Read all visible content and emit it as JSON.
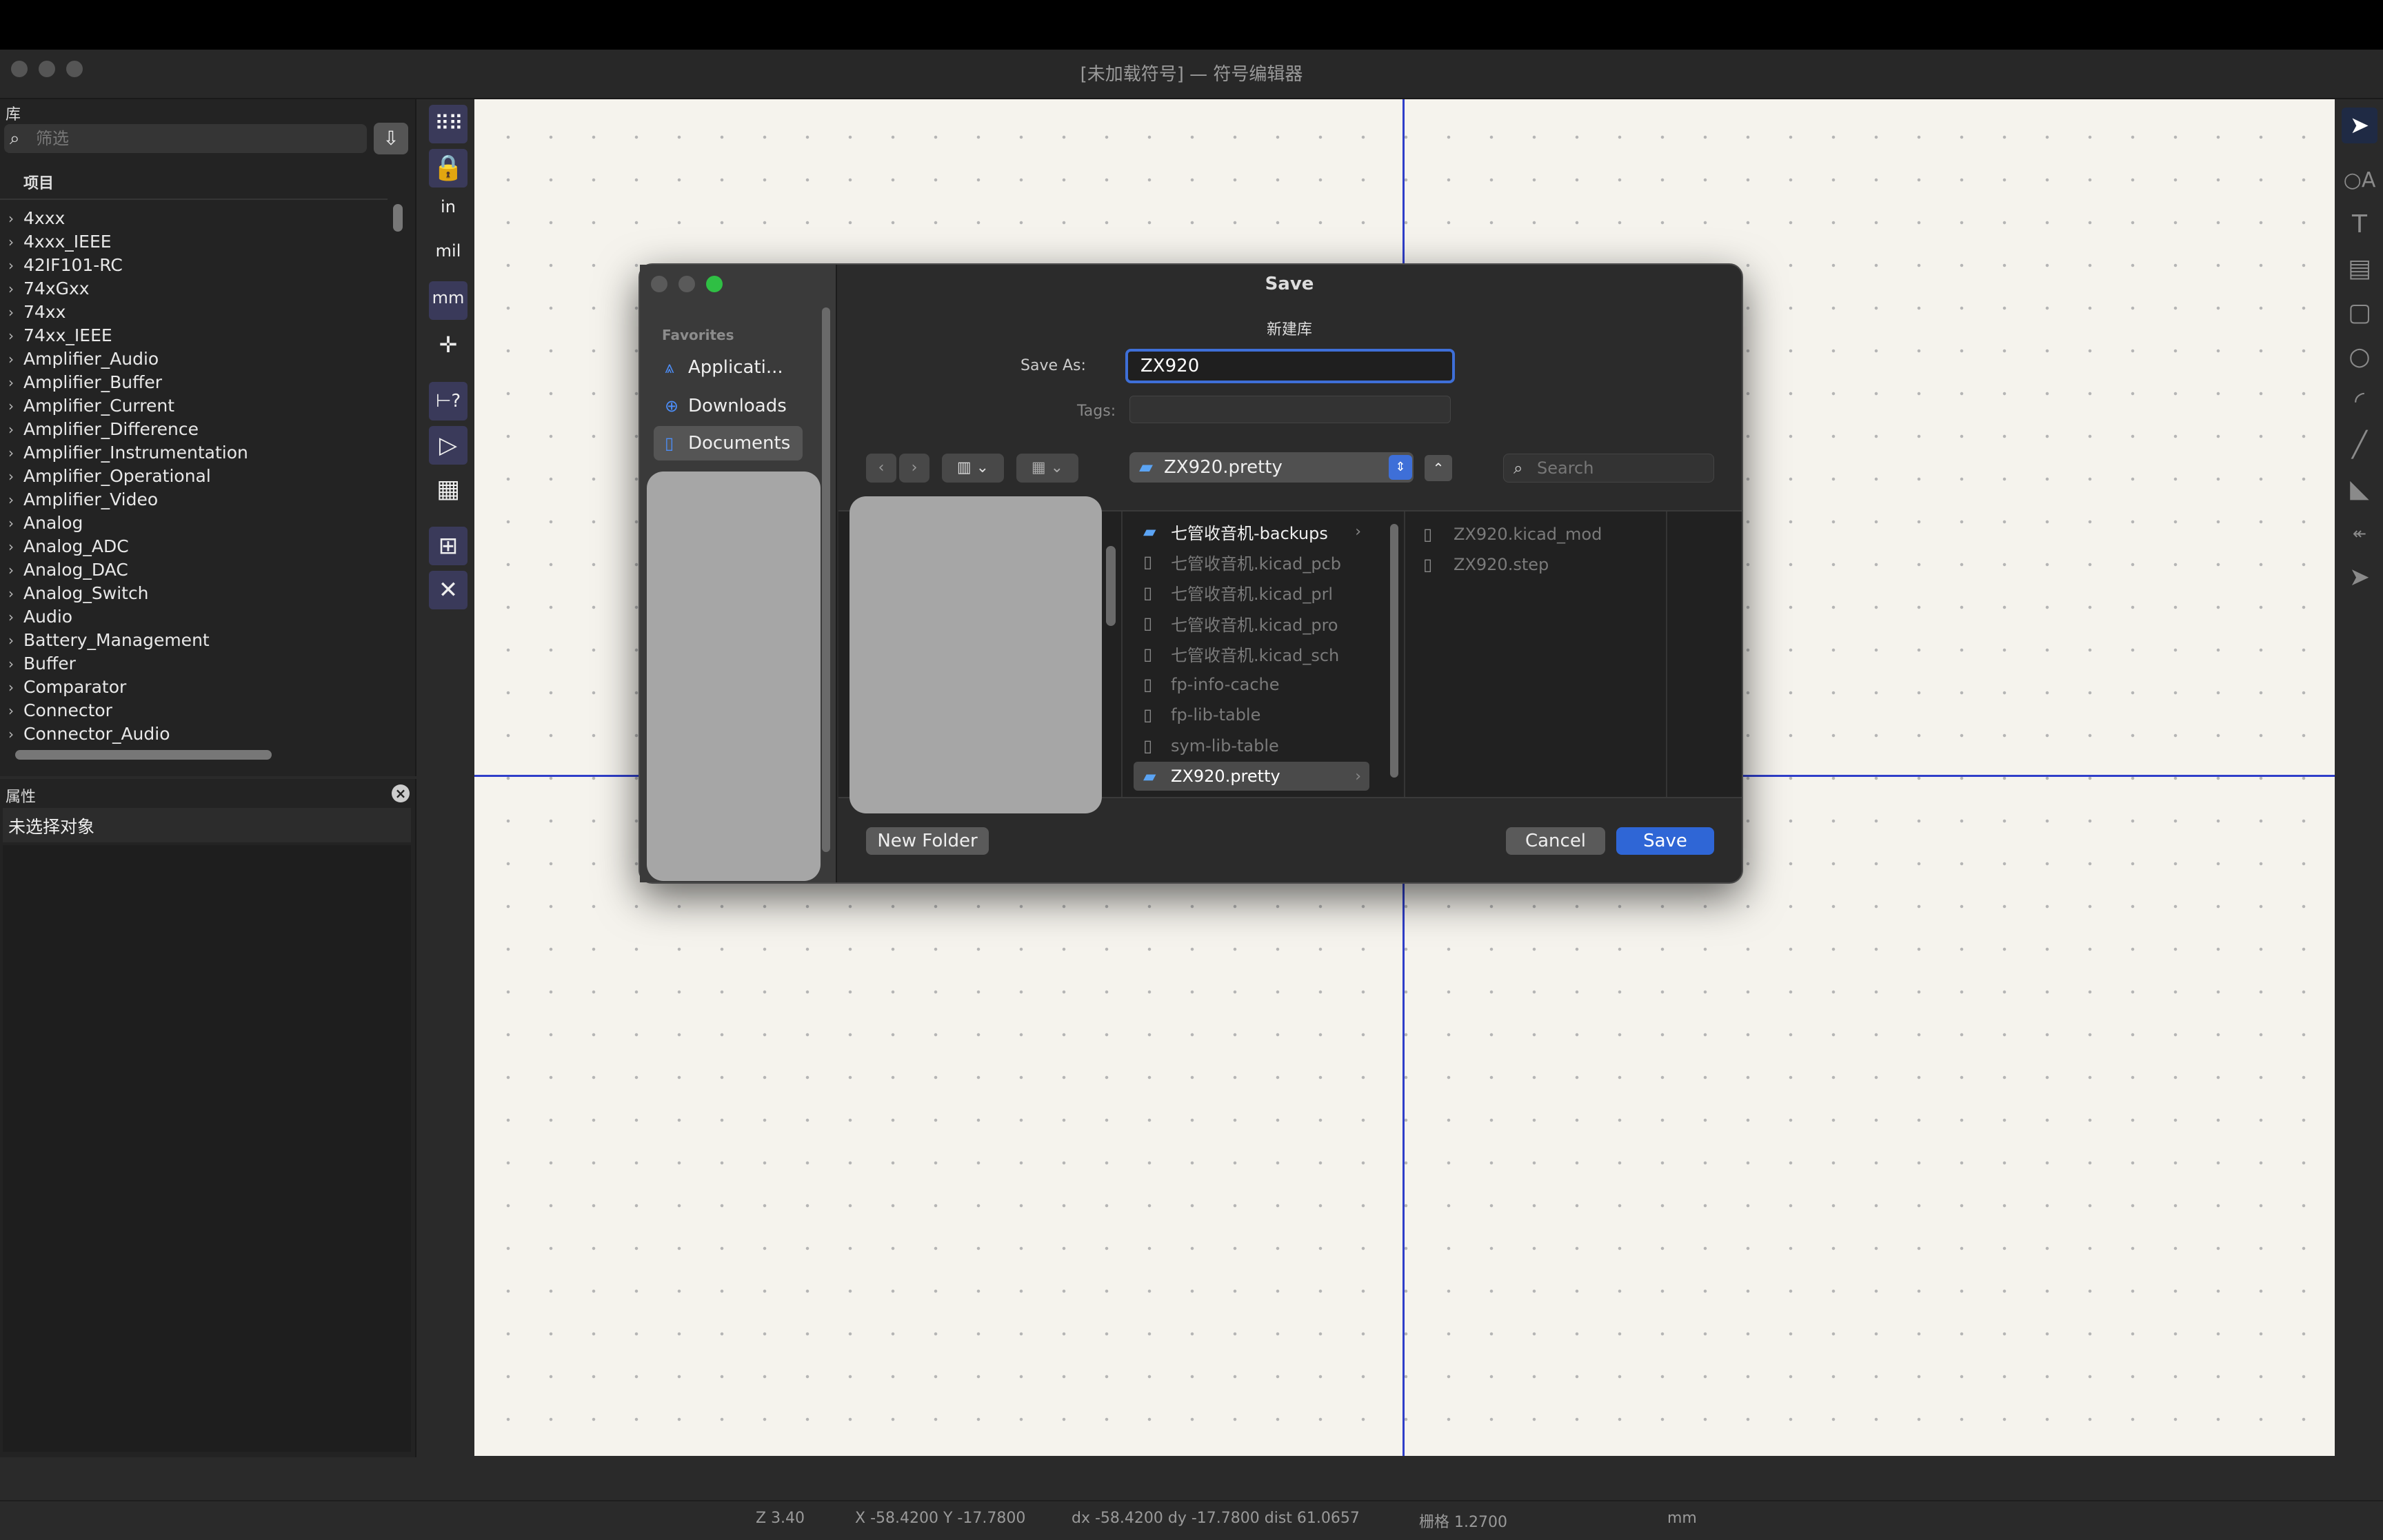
{
  "window": {
    "title": "[未加载符号] — 符号编辑器"
  },
  "library_panel": {
    "title": "库",
    "filter_placeholder": "筛选",
    "column_header": "项目",
    "items": [
      "4xxx",
      "4xxx_IEEE",
      "42IF101-RC",
      "74xGxx",
      "74xx",
      "74xx_IEEE",
      "Amplifier_Audio",
      "Amplifier_Buffer",
      "Amplifier_Current",
      "Amplifier_Difference",
      "Amplifier_Instrumentation",
      "Amplifier_Operational",
      "Amplifier_Video",
      "Analog",
      "Analog_ADC",
      "Analog_DAC",
      "Analog_Switch",
      "Audio",
      "Battery_Management",
      "Buffer",
      "Comparator",
      "Connector",
      "Connector_Audio"
    ]
  },
  "properties_panel": {
    "title": "属性",
    "no_selection": "未选择对象"
  },
  "left_toolbar": {
    "in_label": "in",
    "mil_label": "mil",
    "mm_label": "mm"
  },
  "status_bar": {
    "zoom": "Z 3.40",
    "xy": "X -58.4200  Y -17.7800",
    "delta": "dx -58.4200  dy -17.7800  dist 61.0657",
    "grid": "栅格 1.2700",
    "units": "mm"
  },
  "dialog": {
    "title": "Save",
    "subtitle": "新建库",
    "save_as_label": "Save As:",
    "save_as_value": "ZX920",
    "tags_label": "Tags:",
    "favorites_label": "Favorites",
    "favorites": [
      {
        "label": "Applicati...",
        "icon": "applications-icon"
      },
      {
        "label": "Downloads",
        "icon": "downloads-icon"
      },
      {
        "label": "Documents",
        "icon": "documents-icon"
      }
    ],
    "current_folder": "ZX920.pretty",
    "search_placeholder": "Search",
    "column2": [
      {
        "name": "七管收音机-backups",
        "kind": "folder"
      },
      {
        "name": "七管收音机.kicad_pcb",
        "kind": "file"
      },
      {
        "name": "七管收音机.kicad_prl",
        "kind": "file"
      },
      {
        "name": "七管收音机.kicad_pro",
        "kind": "file"
      },
      {
        "name": "七管收音机.kicad_sch",
        "kind": "file"
      },
      {
        "name": "fp-info-cache",
        "kind": "file"
      },
      {
        "name": "fp-lib-table",
        "kind": "file"
      },
      {
        "name": "sym-lib-table",
        "kind": "file"
      },
      {
        "name": "ZX920.pretty",
        "kind": "folder"
      }
    ],
    "column3": [
      "ZX920.kicad_mod",
      "ZX920.step"
    ],
    "new_folder_label": "New Folder",
    "cancel_label": "Cancel",
    "save_label": "Save"
  }
}
